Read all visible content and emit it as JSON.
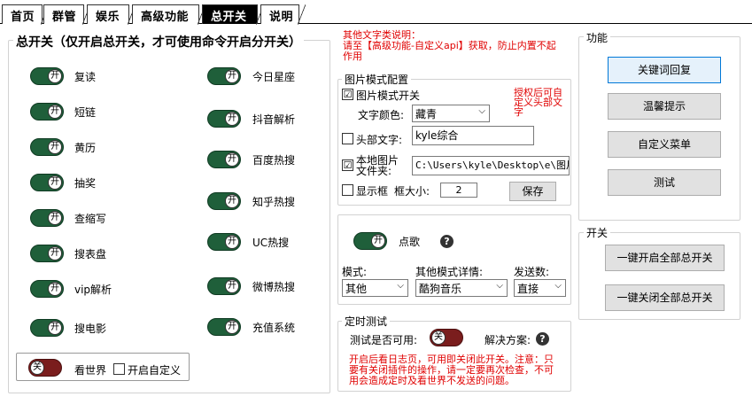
{
  "tabs": [
    "首页",
    "群管",
    "娱乐",
    "高级功能",
    "总开关",
    "说明"
  ],
  "main_group": {
    "title": "总开关（仅开启总开关，才可使用命令开启分开关）",
    "left_items": [
      {
        "label": "复读",
        "state": "开"
      },
      {
        "label": "短链",
        "state": "开"
      },
      {
        "label": "黄历",
        "state": "开"
      },
      {
        "label": "抽奖",
        "state": "开"
      },
      {
        "label": "查缩写",
        "state": "开"
      },
      {
        "label": "搜表盘",
        "state": "开"
      },
      {
        "label": "vip解析",
        "state": "开"
      },
      {
        "label": "搜电影",
        "state": "开"
      }
    ],
    "right_items": [
      {
        "label": "今日星座",
        "state": "开"
      },
      {
        "label": "抖音解析",
        "state": "开"
      },
      {
        "label": "百度热搜",
        "state": "开"
      },
      {
        "label": "知乎热搜",
        "state": "开"
      },
      {
        "label": "UC热搜",
        "state": "开"
      },
      {
        "label": "微博热搜",
        "state": "开"
      },
      {
        "label": "充值系统",
        "state": "开"
      }
    ],
    "world": {
      "state": "关",
      "label": "看世界",
      "custom_label": "开启自定义"
    }
  },
  "other_text_note": "其他文字类说明：\n请至【高级功能-自定义api】获取，防止内置不起作用",
  "image_mode": {
    "title": "图片模式配置",
    "mode_switch_label": "图片模式开关",
    "mode_switch_checked": "☑",
    "auth_note": "授权后可自定义头部文字",
    "text_color_label": "文字颜色:",
    "text_color_value": "藏青",
    "header_text_label": "头部文字:",
    "header_text_value": "kyle综合",
    "local_image_label": "本地图片文件夹:",
    "local_image_path": "C:\\Users\\kyle\\Desktop\\e\\图片",
    "show_frame_label": "显示框",
    "frame_size_label": "框大小:",
    "frame_size_value": "2",
    "save_button": "保存"
  },
  "song": {
    "state": "开",
    "label": "点歌",
    "help": "?",
    "mode_label": "模式:",
    "mode_value": "其他",
    "other_mode_label": "其他模式详情:",
    "other_mode_value": "酷狗音乐",
    "send_count_label": "发送数:",
    "send_count_value": "直接"
  },
  "timer": {
    "title": "定时测试",
    "test_label": "测试是否可用:",
    "state": "关",
    "solution_label": "解决方案:",
    "help": "?",
    "note": "开启后看日志页，可用即关闭此开关。注意：只要有关闭插件的操作，请一定要再次检查，不可用会造成定时及看世界不发送的问题。"
  },
  "features": {
    "title": "功能",
    "buttons": [
      "关键词回复",
      "温馨提示",
      "自定义菜单",
      "测试"
    ]
  },
  "switches": {
    "title": "开关",
    "buttons": [
      "一键开启全部总开关",
      "一键关闭全部总开关"
    ]
  }
}
